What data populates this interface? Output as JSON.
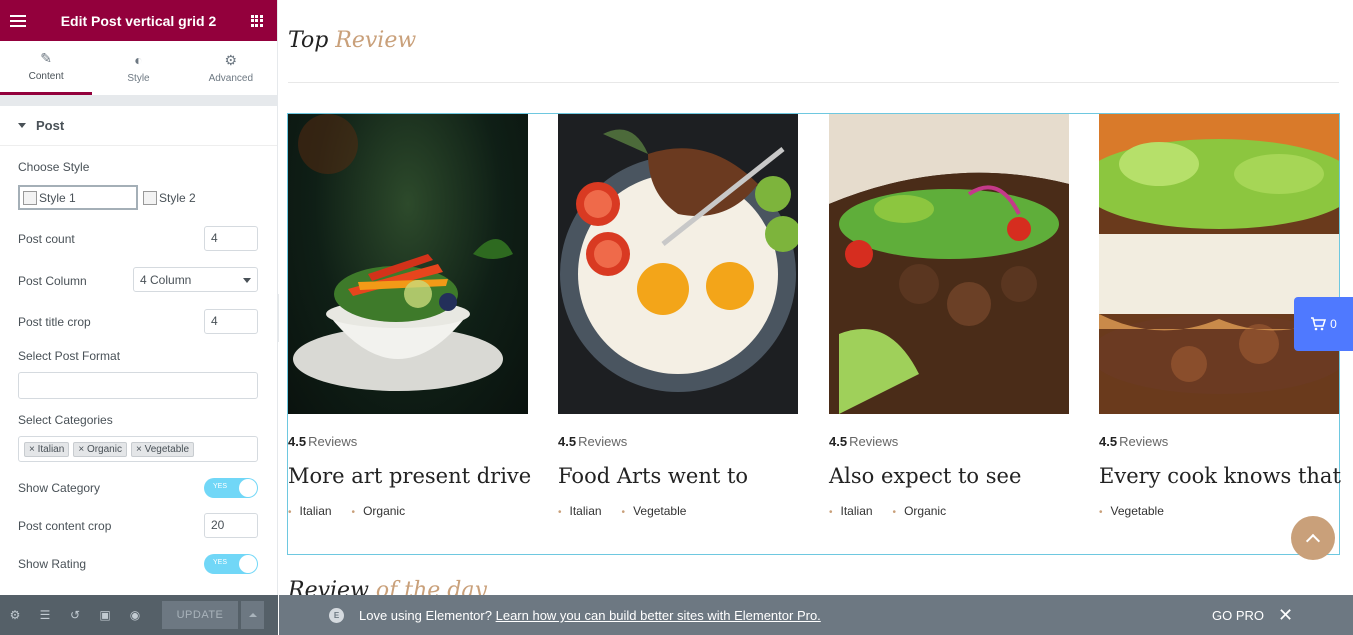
{
  "panel": {
    "title": "Edit Post vertical grid 2",
    "tabs": [
      {
        "label": "Content",
        "icon": "pencil-icon"
      },
      {
        "label": "Style",
        "icon": "half-circle-icon"
      },
      {
        "label": "Advanced",
        "icon": "gear-icon"
      }
    ],
    "section_title": "Post",
    "controls": {
      "choose_style_label": "Choose Style",
      "style_1": "Style 1",
      "style_2": "Style 2",
      "post_count_label": "Post count",
      "post_count_value": "4",
      "post_column_label": "Post Column",
      "post_column_value": "4 Column",
      "post_title_crop_label": "Post title crop",
      "post_title_crop_value": "4",
      "post_format_label": "Select Post Format",
      "post_format_value": "",
      "categories_label": "Select Categories",
      "categories": [
        "Italian",
        "Organic",
        "Vegetable"
      ],
      "show_category_label": "Show Category",
      "show_category_toggle": "YES",
      "post_content_crop_label": "Post content crop",
      "post_content_crop_value": "20",
      "show_rating_label": "Show Rating",
      "show_rating_toggle": "YES"
    },
    "footer": {
      "update_label": "UPDATE"
    }
  },
  "preview": {
    "top_heading": {
      "part1": "Top",
      "part2": "Review"
    },
    "review_day": {
      "part1": "Review",
      "part2": "of the day"
    },
    "cards": [
      {
        "rating": "4.5",
        "reviews": "Reviews",
        "title": "More art present drive",
        "cats": [
          "Italian",
          "Organic"
        ]
      },
      {
        "rating": "4.5",
        "reviews": "Reviews",
        "title": "Food Arts went to",
        "cats": [
          "Italian",
          "Vegetable"
        ]
      },
      {
        "rating": "4.5",
        "reviews": "Reviews",
        "title": "Also expect to see",
        "cats": [
          "Italian",
          "Organic"
        ]
      },
      {
        "rating": "4.5",
        "reviews": "Reviews",
        "title": "Every cook knows that",
        "cats": [
          "Vegetable"
        ]
      }
    ],
    "cart_count": "0"
  },
  "promo": {
    "message": "Love using Elementor?",
    "link": "Learn how you can build better sites with Elementor Pro.",
    "go_pro": "GO PRO",
    "logo_letter": "E"
  },
  "colors": {
    "brand": "#93003c",
    "accent_gold": "#c9a07a",
    "toggle_on": "#71d7f7",
    "cart_blue": "#4f79ff",
    "footer_gray": "#556068"
  }
}
